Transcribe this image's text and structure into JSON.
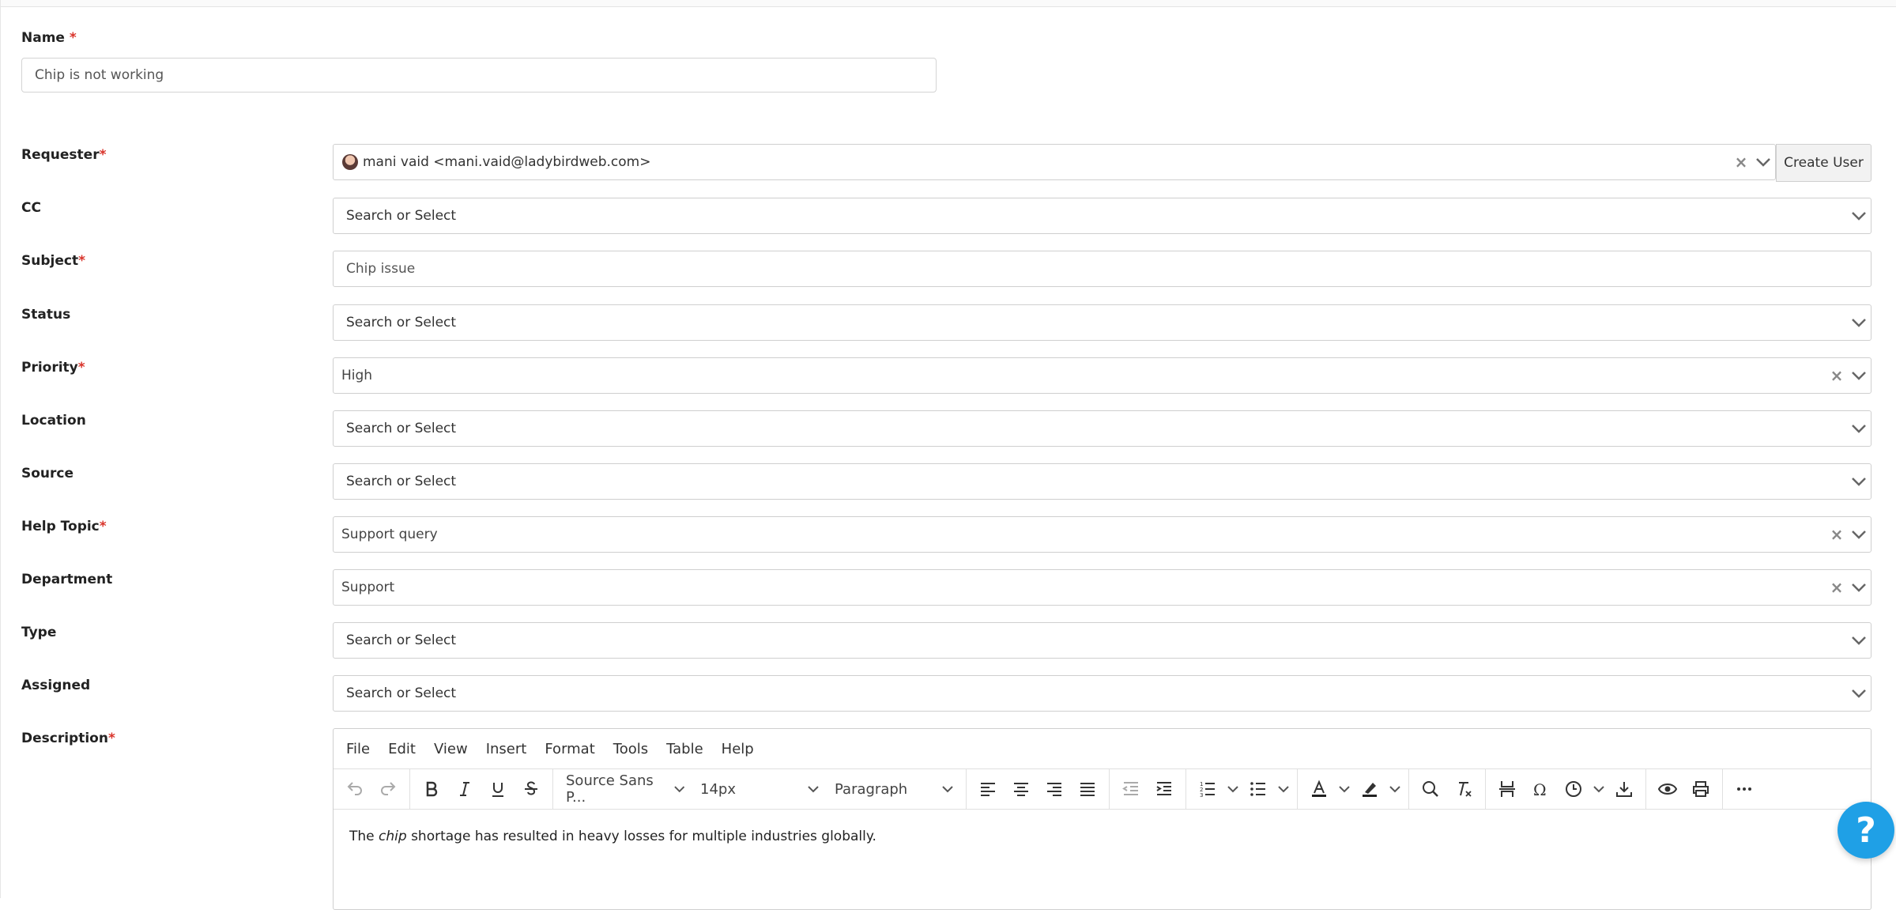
{
  "form": {
    "name_label": "Name",
    "name_value": "Chip is not working",
    "required_mark": "*",
    "requester": {
      "label": "Requester",
      "value": "mani vaid <mani.vaid@ladybirdweb.com>",
      "create_label": "Create User"
    },
    "cc": {
      "label": "CC",
      "placeholder": "Search or Select"
    },
    "subject": {
      "label": "Subject",
      "value": "Chip issue"
    },
    "status": {
      "label": "Status",
      "placeholder": "Search or Select"
    },
    "priority": {
      "label": "Priority",
      "value": "High"
    },
    "location": {
      "label": "Location",
      "placeholder": "Search or Select"
    },
    "source": {
      "label": "Source",
      "placeholder": "Search or Select"
    },
    "help_topic": {
      "label": "Help Topic",
      "value": "Support query"
    },
    "department": {
      "label": "Department",
      "value": "Support"
    },
    "type": {
      "label": "Type",
      "placeholder": "Search or Select"
    },
    "assigned": {
      "label": "Assigned",
      "placeholder": "Search or Select"
    },
    "description": {
      "label": "Description"
    },
    "clear_glyph": "×"
  },
  "editor": {
    "menu": [
      "File",
      "Edit",
      "View",
      "Insert",
      "Format",
      "Tools",
      "Table",
      "Help"
    ],
    "font_family": "Source Sans P...",
    "font_size": "14px",
    "block_format": "Paragraph",
    "content": {
      "pre": "The ",
      "em": "chip",
      "post": " shortage has resulted in heavy losses for multiple industries globally."
    }
  },
  "help_button": {
    "glyph": "?"
  },
  "colors": {
    "required": "#d9342b",
    "help_button": "#1fa0e6"
  }
}
